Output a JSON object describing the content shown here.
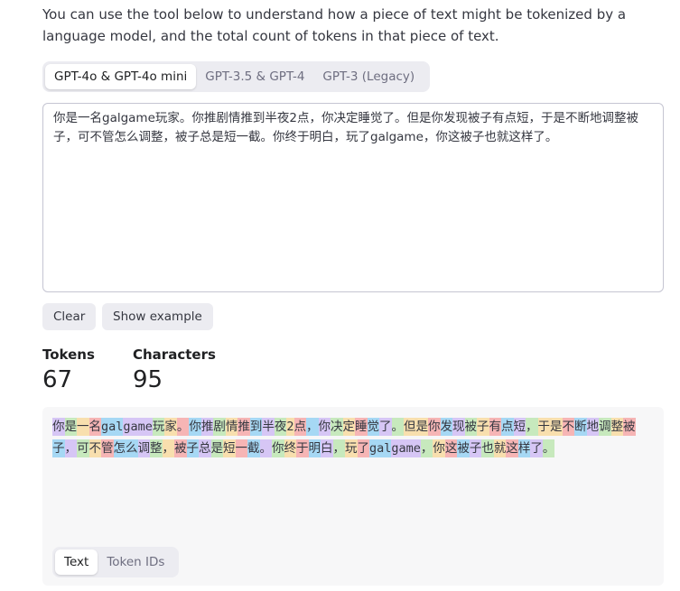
{
  "intro_text": "You can use the tool below to understand how a piece of text might be tokenized by a language model, and the total count of tokens in that piece of text.",
  "model_tabs": [
    {
      "label": "GPT-4o & GPT-4o mini",
      "active": true
    },
    {
      "label": "GPT-3.5 & GPT-4",
      "active": false
    },
    {
      "label": "GPT-3 (Legacy)",
      "active": false
    }
  ],
  "input_text": "你是一名galgame玩家。你推剧情推到半夜2点，你决定睡觉了。但是你发现被子有点短，于是不断地调整被子，可不管怎么调整，被子总是短一截。你终于明白，玩了galgame，你这被子也就这样了。",
  "buttons": {
    "clear": "Clear",
    "show_example": "Show example"
  },
  "stats": {
    "tokens_label": "Tokens",
    "tokens_value": "67",
    "characters_label": "Characters",
    "characters_value": "95"
  },
  "token_colors": [
    "#d6c6f5",
    "#c7e9bd",
    "#f8dfae",
    "#f6b5b5",
    "#a6d8f4"
  ],
  "tokens": [
    "你",
    "是",
    "一",
    "名",
    "gal",
    "game",
    "玩",
    "家",
    "。",
    "你",
    "推",
    "剧",
    "情",
    "推",
    "到",
    "半",
    "夜",
    "2",
    "点",
    "，",
    "你",
    "决",
    "定",
    "睡",
    "觉",
    "了",
    "。",
    "但是",
    "你",
    "发",
    "现",
    "被",
    "子",
    "有",
    "点",
    "短",
    "，",
    "于是",
    "不",
    "断",
    "地",
    "调",
    "整",
    "被",
    "子",
    "，",
    "可",
    "不",
    "管",
    "怎么",
    "调",
    "整",
    "，",
    "被",
    "子",
    "总",
    "是",
    "短",
    "一",
    "截",
    "。",
    "你",
    "终",
    "于",
    "明",
    "白",
    "，",
    "玩",
    "了",
    "gal",
    "game",
    "，",
    "你",
    "这",
    "被",
    "子",
    "也",
    "就",
    "这",
    "样",
    "了",
    "。"
  ],
  "output_view_tabs": [
    {
      "label": "Text",
      "active": true
    },
    {
      "label": "Token IDs",
      "active": false
    }
  ]
}
